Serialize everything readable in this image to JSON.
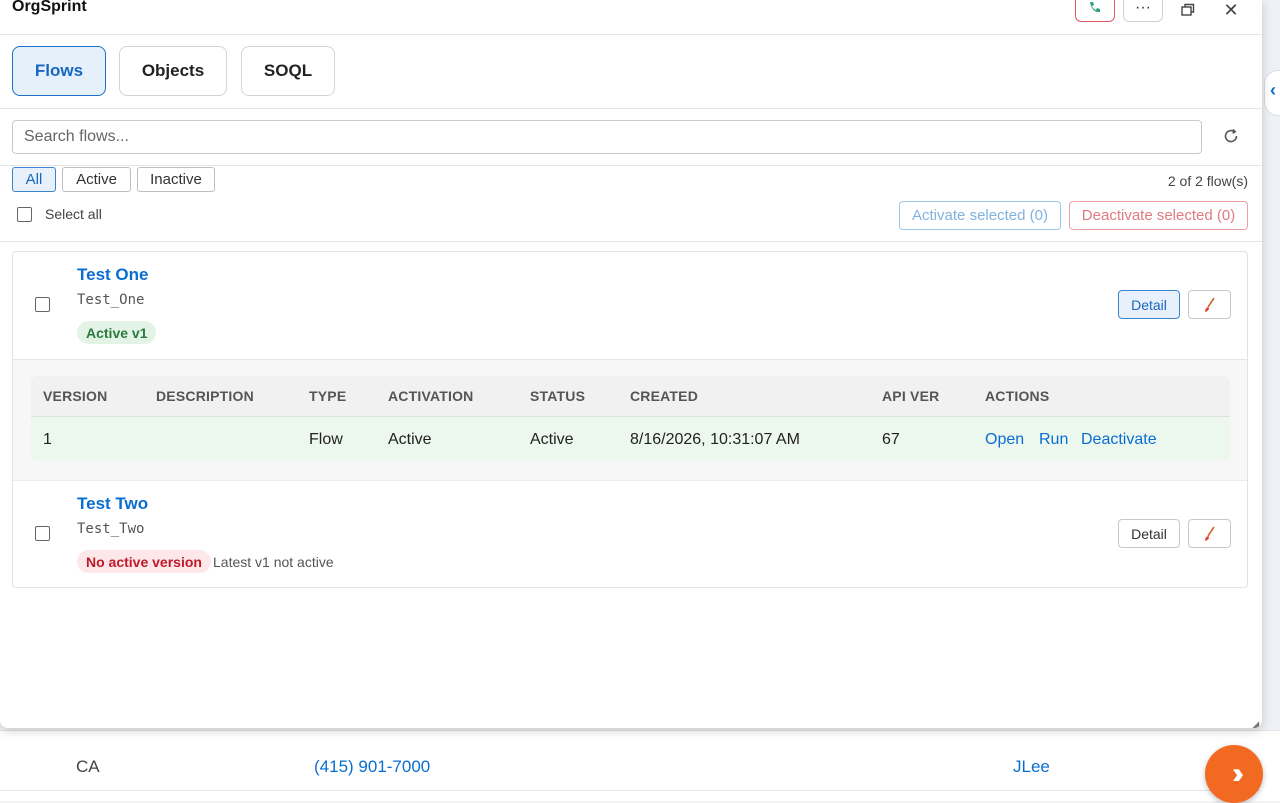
{
  "app": {
    "title": "OrgSprint"
  },
  "tabs": [
    {
      "label": "Flows",
      "active": true
    },
    {
      "label": "Objects",
      "active": false
    },
    {
      "label": "SOQL",
      "active": false
    }
  ],
  "search": {
    "placeholder": "Search flows..."
  },
  "filters": {
    "options": [
      "All",
      "Active",
      "Inactive"
    ],
    "selected": "All",
    "count_text": "2 of 2 flow(s)",
    "select_all_label": "Select all",
    "activate_selected": "Activate selected (0)",
    "deactivate_selected": "Deactivate selected (0)"
  },
  "flows": [
    {
      "name": "Test One",
      "api_name": "Test_One",
      "badge": "Active v1",
      "detail_label": "Detail",
      "versions_table": {
        "columns": [
          "VERSION",
          "DESCRIPTION",
          "TYPE",
          "ACTIVATION",
          "STATUS",
          "CREATED",
          "API VER",
          "ACTIONS"
        ],
        "rows": [
          {
            "version": "1",
            "description": "",
            "type": "Flow",
            "activation": "Active",
            "status": "Active",
            "created": "8/16/2026, 10:31:07 AM",
            "api_ver": "67",
            "actions": [
              "Open",
              "Run",
              "Deactivate"
            ]
          }
        ]
      }
    },
    {
      "name": "Test Two",
      "api_name": "Test_Two",
      "badge": "No active version",
      "note": "Latest v1 not active",
      "detail_label": "Detail"
    }
  ],
  "background_page": {
    "state": "CA",
    "phone": "(415) 901-7000",
    "owner": "JLee"
  },
  "colors": {
    "accent": "#0a6ed1",
    "active_badge_bg": "#e3f3e6",
    "inactive_badge_bg": "#fde7e9",
    "launcher": "#f26a21"
  },
  "icons": {
    "phone": "phone-icon",
    "more": "more-icon",
    "restore": "restore-window-icon",
    "close": "close-icon",
    "refresh": "refresh-icon",
    "edit": "brush-icon",
    "launcher": "launcher-icon"
  }
}
